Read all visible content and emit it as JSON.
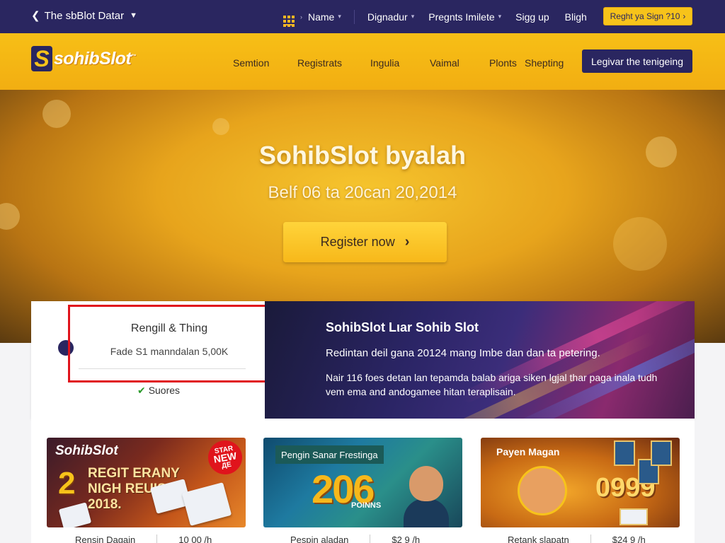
{
  "topbar": {
    "back_label": "The sbBlot Datar",
    "nav": [
      {
        "label": "Name",
        "has_dropdown": true
      },
      {
        "label": "Dignadur",
        "has_dropdown": true
      },
      {
        "label": "Pregnts Imilete",
        "has_dropdown": true
      },
      {
        "label": "Sigg up",
        "has_dropdown": false
      },
      {
        "label": "Bligh",
        "has_dropdown": false
      }
    ],
    "cta_label": "Reght ya Sign ?10"
  },
  "header": {
    "logo_mark": "S",
    "logo_text": "sohibSlot",
    "logo_tm": "™",
    "nav": [
      "Semtion",
      "Registrats",
      "Ingulia",
      "Vaimal",
      "Plonts",
      "Shepting"
    ],
    "button_label": "Legivar the tenigeing"
  },
  "hero": {
    "title": "SohibSlot byalah",
    "subtitle": "Belf 06 ta 20can 20,2014",
    "button_label": "Register now"
  },
  "info": {
    "box_title": "Rengill & Thing",
    "box_desc": "Fade S1 manndalan 5,00K",
    "status": "Suores",
    "right_title": "SohibSlot Lιar Sohib Slot",
    "right_line1": "Redintan deil gana 20124 mang Imbe dan dan ta petering.",
    "right_line2": "Nair 116 foes detan lan tepamda balab ariga siken lgjal thar paga inala tudh vem ema and andogamee hitan teraplisain."
  },
  "cards": [
    {
      "logo": "SohibSlot",
      "big_digit": "2",
      "text": [
        "REGIT ERANY",
        "NIGH REUISL",
        "2018."
      ],
      "badge": [
        "STAR",
        "NEW",
        "ДЕ"
      ],
      "caption": "Rensin Dagain",
      "price": "10 00 /h"
    },
    {
      "label": "Pengin Sanar Frestinga",
      "number": "206",
      "points": "POINNS",
      "caption": "Pespin aladan",
      "price": "$2 9 /h"
    },
    {
      "label": "Payen Magan",
      "number": "0999",
      "caption": "Retank slapatn",
      "price": "$24 9 /h"
    }
  ],
  "colors": {
    "navy": "#2a2660",
    "gold": "#f7c31a",
    "highlight_red": "#e0141c"
  }
}
